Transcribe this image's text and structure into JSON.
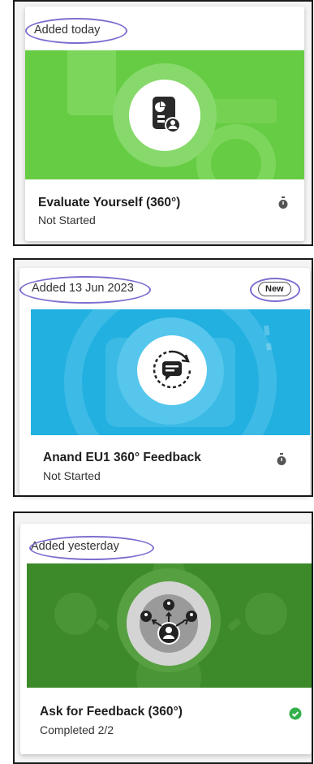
{
  "cards": [
    {
      "added_label": "Added today",
      "title": "Evaluate Yourself (360°)",
      "status": "Not Started",
      "status_icon": "stopwatch-icon",
      "banner_icon": "self-evaluation-icon",
      "banner_color": "#66cc44",
      "badge": ""
    },
    {
      "added_label": "Added 13 Jun 2023",
      "title": "Anand EU1 360° Feedback",
      "status": "Not Started",
      "status_icon": "stopwatch-icon",
      "banner_icon": "feedback-chat-icon",
      "banner_color": "#22b0e0",
      "badge": "New"
    },
    {
      "added_label": "Added yesterday",
      "title": "Ask for Feedback (360°)",
      "status": "Completed 2/2",
      "status_icon": "check-circle-icon",
      "banner_icon": "ask-feedback-network-icon",
      "banner_color": "#3d8a2a",
      "badge": ""
    }
  ],
  "colors": {
    "highlight_oval": "#7b6fd0",
    "completed_green": "#33b04a",
    "stopwatch_gray": "#555555"
  }
}
